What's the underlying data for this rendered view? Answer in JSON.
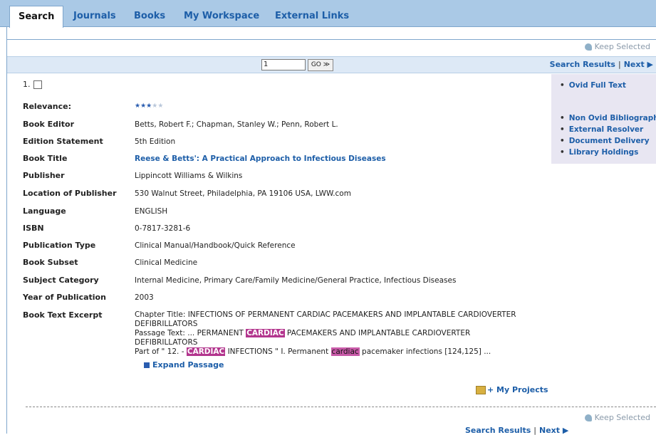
{
  "tabs": [
    {
      "label": "Search",
      "active": true
    },
    {
      "label": "Journals"
    },
    {
      "label": "Books"
    },
    {
      "label": "My Workspace"
    },
    {
      "label": "External Links"
    }
  ],
  "keep_selected": "Keep Selected",
  "nav": {
    "page_value": "1",
    "go_label": "GO ≫",
    "search_results": "Search Results",
    "separator": "|",
    "next": "Next ▶"
  },
  "record": {
    "number": "1.",
    "relevance_label": "Relevance:",
    "relevance_stars": 3,
    "relevance_max": 5,
    "fields": [
      {
        "label": "Book Editor",
        "value": "Betts, Robert F.; Chapman, Stanley W.; Penn, Robert L."
      },
      {
        "label": "Edition Statement",
        "value": "5th Edition"
      },
      {
        "label": "Book Title",
        "value": "Reese & Betts': A Practical Approach to Infectious Diseases",
        "link": true
      },
      {
        "label": "Publisher",
        "value": "Lippincott Williams & Wilkins"
      },
      {
        "label": "Location of Publisher",
        "value": "530 Walnut Street, Philadelphia, PA 19106 USA, LWW.com"
      },
      {
        "label": "Language",
        "value": "ENGLISH"
      },
      {
        "label": "ISBN",
        "value": "0-7817-3281-6"
      },
      {
        "label": "Publication Type",
        "value": "Clinical Manual/Handbook/Quick Reference"
      },
      {
        "label": "Book Subset",
        "value": "Clinical Medicine"
      },
      {
        "label": "Subject Category",
        "value": "Internal Medicine, Primary Care/Family Medicine/General Practice, Infectious Diseases"
      },
      {
        "label": "Year of Publication",
        "value": "2003"
      }
    ],
    "excerpt_label": "Book Text Excerpt",
    "excerpt": {
      "chapter_title": "Chapter Title: INFECTIONS OF PERMANENT CARDIAC PACEMAKERS AND IMPLANTABLE CARDIOVERTER DEFIBRILLATORS",
      "passage_prefix": "Passage Text: ... PERMANENT ",
      "passage_hl": "CARDIAC",
      "passage_suffix": " PACEMAKERS AND IMPLANTABLE CARDIOVERTER DEFIBRILLATORS",
      "partof_prefix": "Part of \" 12. - ",
      "partof_hl": "CARDIAC",
      "partof_mid": " INFECTIONS \" I. Permanent ",
      "partof_hl2": "cardiac",
      "partof_suffix": " pacemaker infections [124,125] ..."
    },
    "expand_passage": "Expand Passage"
  },
  "side_links": [
    "Ovid Full Text",
    "Non Ovid Bibliographic",
    "External Resolver",
    "Document Delivery",
    "Library Holdings"
  ],
  "my_projects": "+ My Projects"
}
